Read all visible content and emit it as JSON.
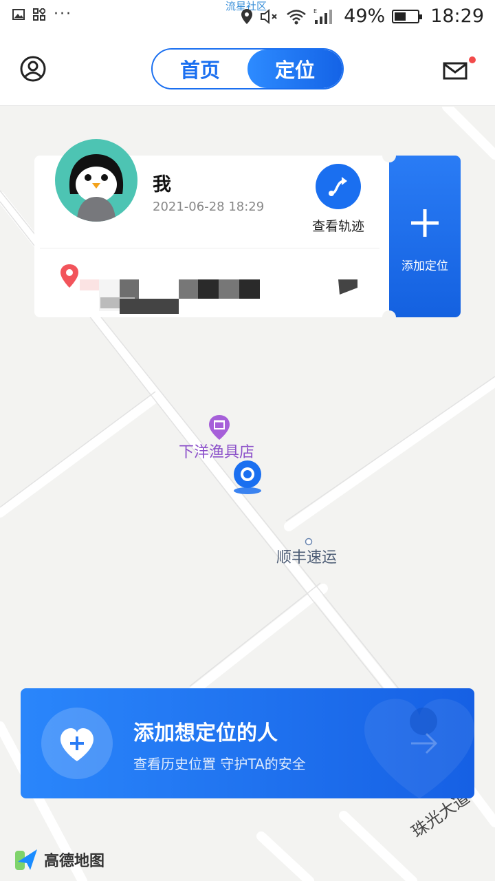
{
  "status_bar": {
    "watermark": "流星社区",
    "battery_pct": "49%",
    "time": "18:29",
    "battery_level": 0.49
  },
  "header": {
    "tabs": [
      {
        "label": "首页",
        "active": false
      },
      {
        "label": "定位",
        "active": true
      }
    ],
    "has_unread_mail": true
  },
  "location_card": {
    "name": "我",
    "timestamp": "2021-06-28 18:29",
    "track_label": "查看轨迹",
    "address": ""
  },
  "add_location": {
    "label": "添加定位"
  },
  "map": {
    "pois": [
      {
        "name": "下洋渔具店",
        "type": "shop"
      },
      {
        "name": "顺丰速运",
        "type": "place"
      }
    ],
    "road_name": "珠光大道",
    "provider": "高德地图"
  },
  "banner": {
    "title": "添加想定位的人",
    "subtitle": "查看历史位置 守护TA的安全"
  },
  "colors": {
    "brand_blue": "#1a6ff0",
    "pin_red": "#f24b4b",
    "poi_purple": "#8b4fc9",
    "avatar_bg": "#4dc4b3"
  }
}
